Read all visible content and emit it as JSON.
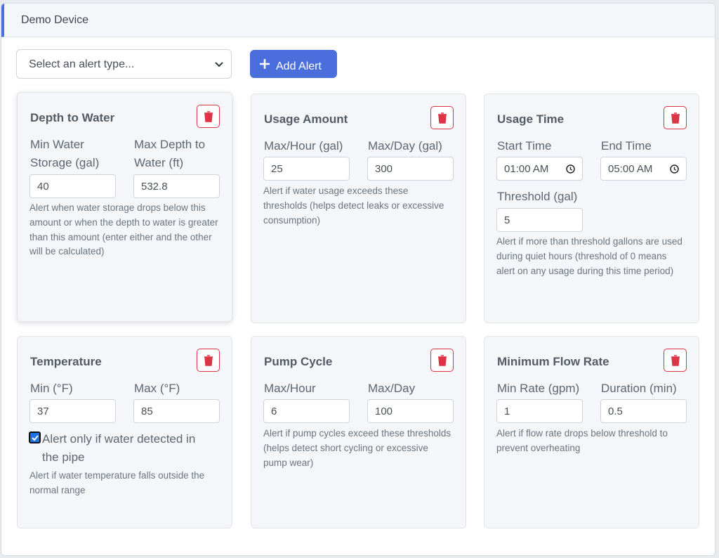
{
  "header": {
    "title": "Demo Device"
  },
  "toolbar": {
    "select_placeholder": "Select an alert type...",
    "add_label": "Add Alert"
  },
  "colors": {
    "accent": "#4a6fdc",
    "danger": "#dc3545",
    "card_bg": "#f5f6fa"
  },
  "cards": {
    "depth": {
      "title": "Depth to Water",
      "label1": "Min Water Storage (gal)",
      "label2": "Max Depth to Water (ft)",
      "value1": "40",
      "value2": "532.8",
      "help": "Alert when water storage drops below this amount or when the depth to water is greater than this amount (enter either and the other will be calculated)"
    },
    "usage_amount": {
      "title": "Usage Amount",
      "label1": "Max/Hour (gal)",
      "label2": "Max/Day (gal)",
      "value1": "25",
      "value2": "300",
      "help": "Alert if water usage exceeds these thresholds (helps detect leaks or excessive consumption)"
    },
    "usage_time": {
      "title": "Usage Time",
      "label1": "Start Time",
      "label2": "End Time",
      "value1": "01:00 AM",
      "value2": "05:00 AM",
      "label3": "Threshold (gal)",
      "value3": "5",
      "help": "Alert if more than threshold gallons are used during quiet hours (threshold of 0 means alert on any usage during this time period)"
    },
    "temperature": {
      "title": "Temperature",
      "label1": "Min (°F)",
      "label2": "Max (°F)",
      "value1": "37",
      "value2": "85",
      "checkbox_label": "Alert only if water detected in the pipe",
      "checkbox_checked": true,
      "help": "Alert if water temperature falls outside the normal range"
    },
    "pump_cycle": {
      "title": "Pump Cycle",
      "label1": "Max/Hour",
      "label2": "Max/Day",
      "value1": "6",
      "value2": "100",
      "help": "Alert if pump cycles exceed these thresholds (helps detect short cycling or excessive pump wear)"
    },
    "min_flow": {
      "title": "Minimum Flow Rate",
      "label1": "Min Rate (gpm)",
      "label2": "Duration (min)",
      "value1": "1",
      "value2": "0.5",
      "help": "Alert if flow rate drops below threshold to prevent overheating"
    }
  }
}
